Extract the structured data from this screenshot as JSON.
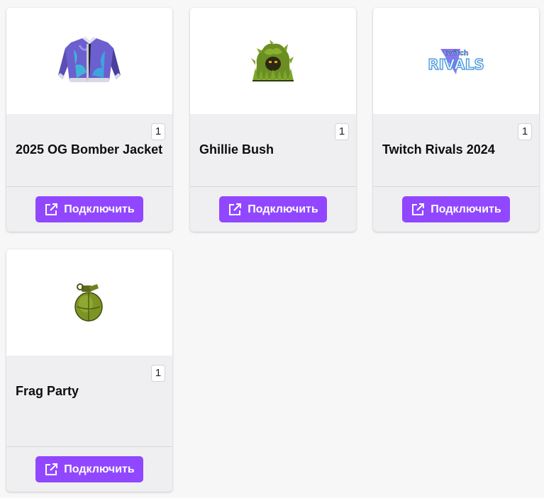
{
  "cards": [
    {
      "title": "2025 OG Bomber Jacket",
      "count": "1",
      "button_label": "Подключить",
      "image": "bomber-jacket-icon"
    },
    {
      "title": "Ghillie Bush",
      "count": "1",
      "button_label": "Подключить",
      "image": "ghillie-bush-icon"
    },
    {
      "title": "Twitch Rivals 2024",
      "count": "1",
      "button_label": "Подключить",
      "image": "twitch-rivals-logo"
    },
    {
      "title": "Frag Party",
      "count": "1",
      "button_label": "Подключить",
      "image": "frag-grenade-icon"
    }
  ],
  "colors": {
    "accent": "#9147ff",
    "card_bg": "#efeff1",
    "page_bg": "#f7f7f8"
  }
}
